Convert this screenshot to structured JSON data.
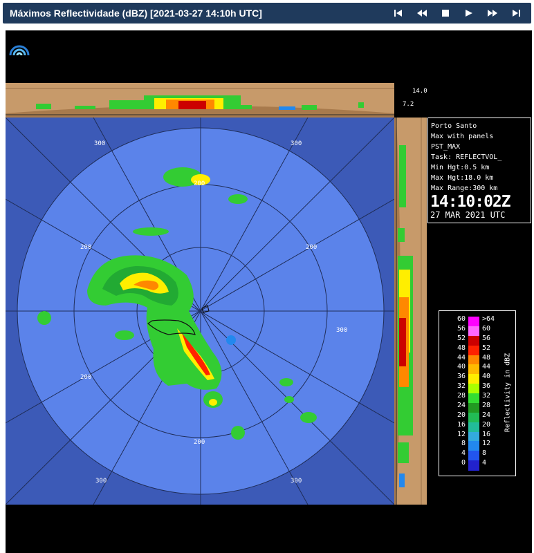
{
  "header": {
    "title": "Máximos Reflectividade (dBZ) [2021-03-27 14:10h UTC]",
    "controls": [
      {
        "name": "first-frame-button",
        "icon": "skip-back-icon"
      },
      {
        "name": "previous-frame-button",
        "icon": "rewind-icon"
      },
      {
        "name": "stop-button",
        "icon": "stop-icon"
      },
      {
        "name": "play-button",
        "icon": "play-icon"
      },
      {
        "name": "next-frame-button",
        "icon": "fast-forward-icon"
      },
      {
        "name": "last-frame-button",
        "icon": "skip-forward-icon"
      }
    ]
  },
  "radar": {
    "height_labels": [
      "14.0",
      "7.2"
    ],
    "range_labels": [
      "300",
      "300",
      "200",
      "200",
      "200",
      "200",
      "300",
      "300",
      "200",
      "300"
    ],
    "info": {
      "site": "Porto Santo",
      "product": "Max with panels",
      "product_id": "PST_MAX",
      "task": "Task: REFLECTVOL_",
      "min_height": "Min Hgt:0.5 km",
      "max_height": "Max Hgt:18.0 km",
      "max_range": "Max Range:300 km",
      "time": "14:10:02Z",
      "date": "27 MAR 2021 UTC"
    }
  },
  "legend": {
    "title": "Reflectivity in dBZ",
    "left_values": [
      "60",
      "56",
      "52",
      "48",
      "44",
      "40",
      "36",
      "32",
      "28",
      "24",
      "20",
      "16",
      "12",
      "8",
      "4",
      "0"
    ],
    "right_values": [
      ">64",
      "60",
      "56",
      "52",
      "48",
      "44",
      "40",
      "36",
      "32",
      "28",
      "24",
      "20",
      "16",
      "12",
      "8",
      "4"
    ],
    "colors": [
      "#ff00ff",
      "#ff66ff",
      "#cc0000",
      "#ff2200",
      "#ff8800",
      "#ffbb00",
      "#ffee00",
      "#aaff00",
      "#33dd33",
      "#229922",
      "#22bb55",
      "#22bb99",
      "#33aadd",
      "#2288ee",
      "#2255ee",
      "#2222cc"
    ]
  },
  "colors": {
    "header_bg": "#1f3a5c",
    "radar_disk": "#5b83ea",
    "outside_area": "#3c5ab7",
    "panel_tan": "#c79a6a"
  }
}
